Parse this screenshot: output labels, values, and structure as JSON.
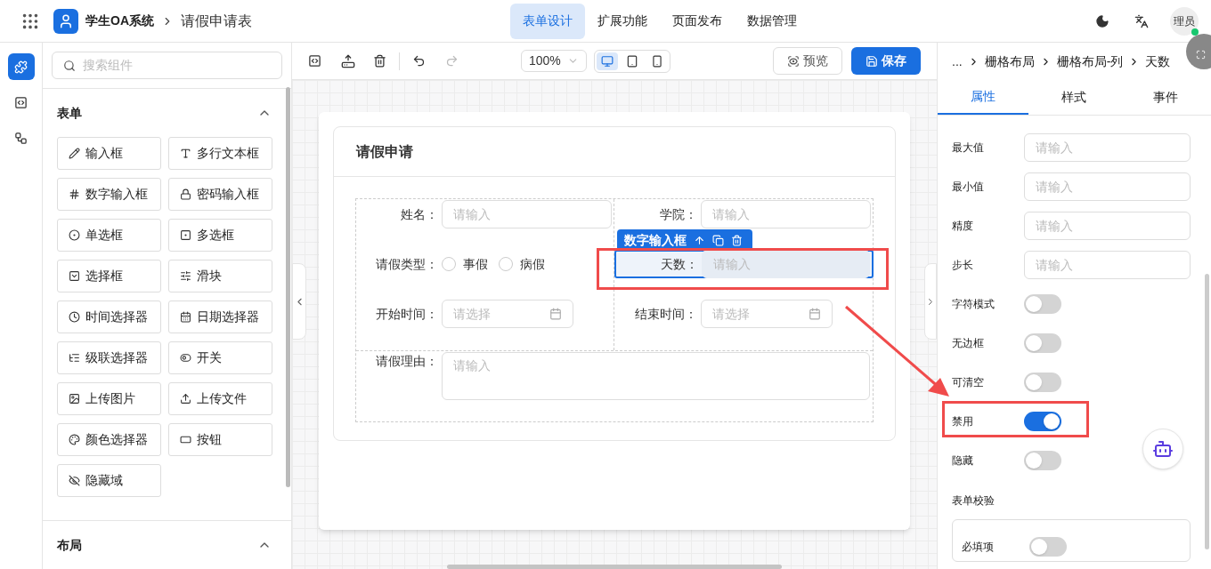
{
  "header": {
    "app_name": "学生OA系统",
    "page_title": "请假申请表",
    "avatar_text": "理员",
    "nav": [
      {
        "label": "表单设计",
        "selected": true
      },
      {
        "label": "扩展功能",
        "selected": false
      },
      {
        "label": "页面发布",
        "selected": false
      },
      {
        "label": "数据管理",
        "selected": false
      }
    ]
  },
  "rail": [
    {
      "kind": "components",
      "selected": true
    },
    {
      "kind": "code",
      "selected": false
    },
    {
      "kind": "tree",
      "selected": false
    }
  ],
  "component_search": {
    "placeholder": "搜索组件"
  },
  "groups": [
    {
      "title": "表单",
      "expanded": true,
      "items": [
        {
          "kind": "input",
          "label": "输入框"
        },
        {
          "kind": "textarea",
          "label": "多行文本框"
        },
        {
          "kind": "number",
          "label": "数字输入框"
        },
        {
          "kind": "password",
          "label": "密码输入框"
        },
        {
          "kind": "radio",
          "label": "单选框"
        },
        {
          "kind": "checkbox",
          "label": "多选框"
        },
        {
          "kind": "select",
          "label": "选择框"
        },
        {
          "kind": "slider",
          "label": "滑块"
        },
        {
          "kind": "time",
          "label": "时间选择器"
        },
        {
          "kind": "date",
          "label": "日期选择器"
        },
        {
          "kind": "cascader",
          "label": "级联选择器"
        },
        {
          "kind": "switch",
          "label": "开关"
        },
        {
          "kind": "image",
          "label": "上传图片"
        },
        {
          "kind": "file",
          "label": "上传文件"
        },
        {
          "kind": "color",
          "label": "颜色选择器"
        },
        {
          "kind": "button",
          "label": "按钮"
        },
        {
          "kind": "hidden",
          "label": "隐藏域"
        }
      ]
    },
    {
      "title": "布局",
      "expanded": true
    }
  ],
  "toolbar": {
    "zoom": "100%",
    "preview": "预览",
    "save": "保存",
    "devices": [
      {
        "kind": "desktop",
        "selected": true
      },
      {
        "kind": "tablet",
        "selected": false
      },
      {
        "kind": "phone",
        "selected": false
      }
    ]
  },
  "form": {
    "title": "请假申请",
    "left": [
      {
        "kind": "input",
        "label": "姓名：",
        "placeholder": "请输入",
        "selected": false
      },
      {
        "kind": "radio",
        "label": "请假类型：",
        "options": [
          {
            "label": "事假",
            "selected": false
          },
          {
            "label": "病假",
            "selected": false
          }
        ]
      },
      {
        "kind": "date",
        "label": "开始时间：",
        "placeholder": "请选择"
      }
    ],
    "right": [
      {
        "kind": "input",
        "label": "学院：",
        "placeholder": "请输入",
        "selected": false
      },
      {
        "kind": "input",
        "label": "天数：",
        "placeholder": "请输入",
        "selected": true
      },
      {
        "kind": "date",
        "label": "结束时间：",
        "placeholder": "请选择"
      }
    ],
    "full": [
      {
        "kind": "textarea",
        "label": "请假理由：",
        "placeholder": "请输入"
      }
    ]
  },
  "selection_toolbar": {
    "label": "数字输入框"
  },
  "properties": {
    "breadcrumb": [
      "...",
      "栅格布局",
      "栅格布局-列",
      "天数"
    ],
    "tabs": [
      {
        "label": "属性",
        "selected": true
      },
      {
        "label": "样式",
        "selected": false
      },
      {
        "label": "事件",
        "selected": false
      }
    ],
    "rows": [
      {
        "kind": "input",
        "label": "最大值",
        "placeholder": "请输入"
      },
      {
        "kind": "input",
        "label": "最小值",
        "placeholder": "请输入"
      },
      {
        "kind": "input",
        "label": "精度",
        "placeholder": "请输入"
      },
      {
        "kind": "input",
        "label": "步长",
        "placeholder": "请输入"
      },
      {
        "kind": "switch",
        "label": "字符模式",
        "on": false
      },
      {
        "kind": "switch",
        "label": "无边框",
        "on": false
      },
      {
        "kind": "switch",
        "label": "可清空",
        "on": false
      },
      {
        "kind": "switch",
        "label": "禁用",
        "on": true
      },
      {
        "kind": "switch",
        "label": "隐藏",
        "on": false
      }
    ],
    "validation": {
      "title": "表单校验",
      "rows": [
        {
          "label": "必填项",
          "on": false
        }
      ]
    }
  }
}
